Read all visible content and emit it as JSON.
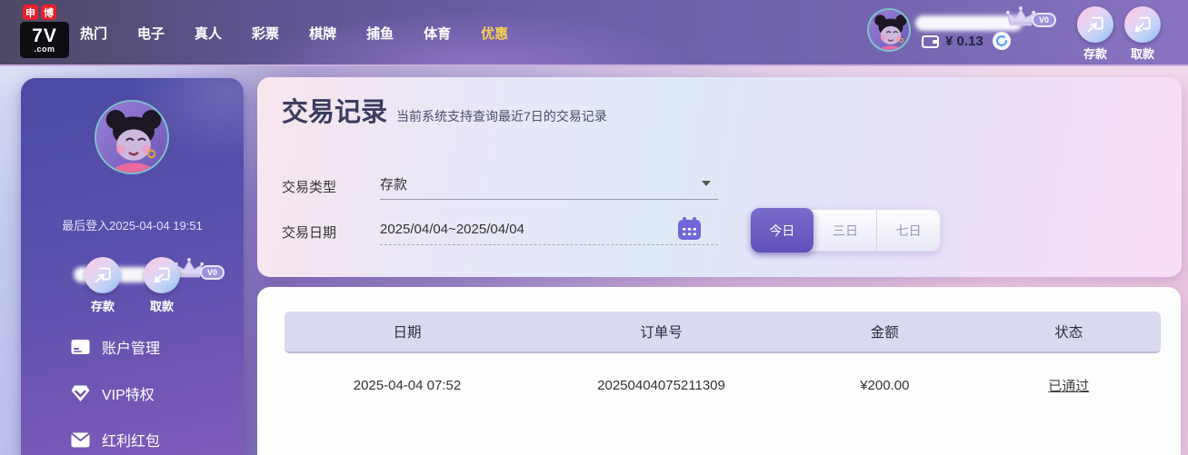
{
  "topbar": {
    "logo": {
      "badge_left": "申",
      "badge_right": "博",
      "name": "7V",
      "tld": ".com"
    },
    "nav": [
      "热门",
      "电子",
      "真人",
      "彩票",
      "棋牌",
      "捕鱼",
      "体育",
      "优惠"
    ],
    "user": {
      "vip_badge": "V0",
      "balance": "¥ 0.13"
    },
    "deposit_label": "存款",
    "withdraw_label": "取款"
  },
  "sidebar": {
    "vip_badge": "V0",
    "last_login": "最后登入2025-04-04 19:51",
    "deposit_label": "存款",
    "withdraw_label": "取款",
    "menu": [
      "账户管理",
      "VIP特权",
      "红利红包"
    ]
  },
  "main": {
    "title": "交易记录",
    "subtitle": "当前系统支持查询最近7日的交易记录",
    "form": {
      "type_label": "交易类型",
      "type_value": "存款",
      "date_label": "交易日期",
      "date_value": "2025/04/04~2025/04/04",
      "ranges": [
        "今日",
        "三日",
        "七日"
      ]
    },
    "table": {
      "headers": [
        "日期",
        "订单号",
        "金额",
        "状态"
      ],
      "rows": [
        [
          "2025-04-04 07:52",
          "20250404075211309",
          "¥200.00",
          "已通过"
        ]
      ]
    }
  },
  "colors": {
    "accent_purple": "#6a5cc4",
    "nav_active_yellow": "#f7d052",
    "sidebar_top": "#4b49a4",
    "sidebar_bottom": "#7e5cba",
    "table_header_bg": "#d9d9f1"
  }
}
